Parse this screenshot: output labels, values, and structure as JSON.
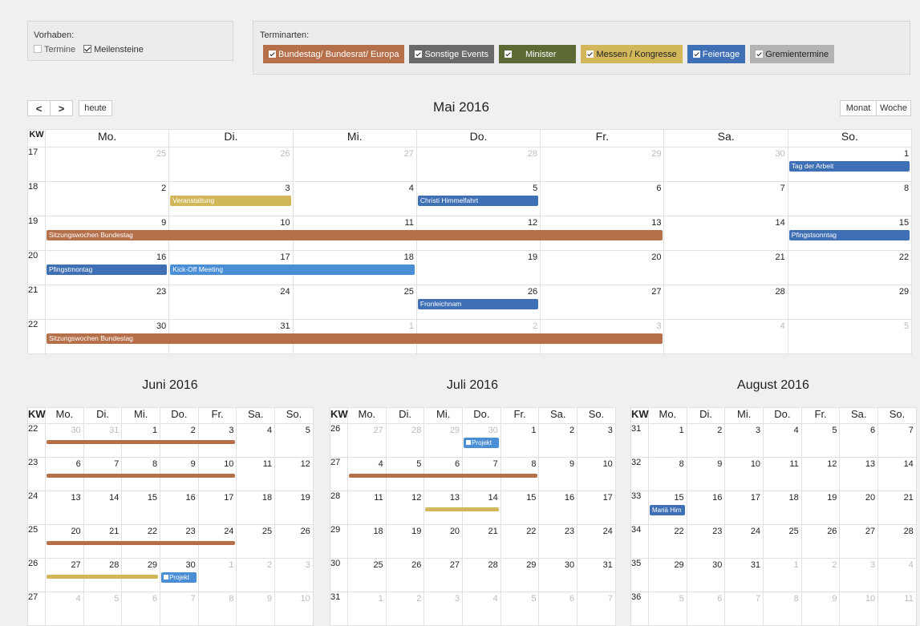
{
  "vorhaben": {
    "title": "Vorhaben:",
    "items": [
      {
        "label": "Termine",
        "checked": false
      },
      {
        "label": "Meilensteine",
        "checked": true
      }
    ]
  },
  "terminarten": {
    "title": "Terminarten:",
    "items": [
      {
        "label": "Bundestag/ Bundesrat/ Europa",
        "color": "#b5704a",
        "text_color": "#ffffff",
        "checked": true
      },
      {
        "label": "Sonstige Events",
        "color": "#6a6a6a",
        "text_color": "#ffffff",
        "checked": true
      },
      {
        "label": "Minister",
        "color": "#5c6a36",
        "text_color": "#ffffff",
        "checked": true
      },
      {
        "label": "Messen / Kongresse",
        "color": "#d1b75a",
        "text_color": "#222222",
        "checked": true
      },
      {
        "label": "Feiertage",
        "color": "#3f6fb5",
        "text_color": "#ffffff",
        "checked": true
      },
      {
        "label": "Gremientermine",
        "color": "#b3b3b3",
        "text_color": "#222222",
        "checked": true
      }
    ]
  },
  "toolbar": {
    "prev_label": "<",
    "next_label": ">",
    "today_label": "heute",
    "title": "Mai 2016",
    "month_label": "Monat",
    "week_label": "Woche"
  },
  "colors": {
    "bundestag": "#b5704a",
    "feiertag": "#3f6fb5",
    "messen": "#d1b75a",
    "event": "#4a8fd6"
  },
  "main_calendar": {
    "kw_header": "KW",
    "weekdays": [
      "Mo.",
      "Di.",
      "Mi.",
      "Do.",
      "Fr.",
      "Sa.",
      "So."
    ],
    "weeks": [
      {
        "kw": "17",
        "days": [
          {
            "n": "25",
            "o": true
          },
          {
            "n": "26",
            "o": true
          },
          {
            "n": "27",
            "o": true
          },
          {
            "n": "28",
            "o": true
          },
          {
            "n": "29",
            "o": true
          },
          {
            "n": "30",
            "o": true
          },
          {
            "n": "1",
            "o": false
          }
        ]
      },
      {
        "kw": "18",
        "days": [
          {
            "n": "2",
            "o": false
          },
          {
            "n": "3",
            "o": false
          },
          {
            "n": "4",
            "o": false
          },
          {
            "n": "5",
            "o": false
          },
          {
            "n": "6",
            "o": false
          },
          {
            "n": "7",
            "o": false
          },
          {
            "n": "8",
            "o": false
          }
        ]
      },
      {
        "kw": "19",
        "days": [
          {
            "n": "9",
            "o": false
          },
          {
            "n": "10",
            "o": false
          },
          {
            "n": "11",
            "o": false
          },
          {
            "n": "12",
            "o": false
          },
          {
            "n": "13",
            "o": false
          },
          {
            "n": "14",
            "o": false
          },
          {
            "n": "15",
            "o": false
          }
        ]
      },
      {
        "kw": "20",
        "days": [
          {
            "n": "16",
            "o": false
          },
          {
            "n": "17",
            "o": false
          },
          {
            "n": "18",
            "o": false
          },
          {
            "n": "19",
            "o": false
          },
          {
            "n": "20",
            "o": false
          },
          {
            "n": "21",
            "o": false
          },
          {
            "n": "22",
            "o": false
          }
        ]
      },
      {
        "kw": "21",
        "days": [
          {
            "n": "23",
            "o": false
          },
          {
            "n": "24",
            "o": false
          },
          {
            "n": "25",
            "o": false
          },
          {
            "n": "26",
            "o": false
          },
          {
            "n": "27",
            "o": false
          },
          {
            "n": "28",
            "o": false
          },
          {
            "n": "29",
            "o": false
          }
        ]
      },
      {
        "kw": "22",
        "days": [
          {
            "n": "30",
            "o": false
          },
          {
            "n": "31",
            "o": false
          },
          {
            "n": "1",
            "o": true
          },
          {
            "n": "2",
            "o": true
          },
          {
            "n": "3",
            "o": true
          },
          {
            "n": "4",
            "o": true
          },
          {
            "n": "5",
            "o": true
          }
        ]
      }
    ],
    "events": [
      {
        "week": 0,
        "start": 6,
        "span": 1,
        "label": "Tag der Arbeit",
        "color": "#3f6fb5"
      },
      {
        "week": 1,
        "start": 1,
        "span": 1,
        "label": "Veranstaltung",
        "color": "#d1b75a"
      },
      {
        "week": 1,
        "start": 3,
        "span": 1,
        "label": "Christi Himmelfahrt",
        "color": "#3f6fb5"
      },
      {
        "week": 2,
        "start": 0,
        "span": 5,
        "label": "Sitzungswochen Bundestag",
        "color": "#b5704a"
      },
      {
        "week": 2,
        "start": 6,
        "span": 1,
        "label": "Pfingstsonntag",
        "color": "#3f6fb5"
      },
      {
        "week": 3,
        "start": 0,
        "span": 1,
        "label": "Pfingstmontag",
        "color": "#3f6fb5"
      },
      {
        "week": 3,
        "start": 1,
        "span": 2,
        "label": "Kick-Off Meeting",
        "color": "#4a8fd6"
      },
      {
        "week": 4,
        "start": 3,
        "span": 1,
        "label": "Fronleichnam",
        "color": "#3f6fb5"
      },
      {
        "week": 5,
        "start": 0,
        "span": 5,
        "label": "Sitzungswochen Bundestag",
        "color": "#b5704a"
      }
    ]
  },
  "small_calendars": [
    {
      "title": "Juni 2016",
      "kw_header": "KW",
      "weekdays": [
        "Mo.",
        "Di.",
        "Mi.",
        "Do.",
        "Fr.",
        "Sa.",
        "So."
      ],
      "weeks": [
        {
          "kw": "22",
          "days": [
            {
              "n": "30",
              "o": true
            },
            {
              "n": "31",
              "o": true
            },
            {
              "n": "1",
              "o": false
            },
            {
              "n": "2",
              "o": false
            },
            {
              "n": "3",
              "o": false
            },
            {
              "n": "4",
              "o": false
            },
            {
              "n": "5",
              "o": false
            }
          ]
        },
        {
          "kw": "23",
          "days": [
            {
              "n": "6",
              "o": false
            },
            {
              "n": "7",
              "o": false
            },
            {
              "n": "8",
              "o": false
            },
            {
              "n": "9",
              "o": false
            },
            {
              "n": "10",
              "o": false
            },
            {
              "n": "11",
              "o": false
            },
            {
              "n": "12",
              "o": false
            }
          ]
        },
        {
          "kw": "24",
          "days": [
            {
              "n": "13",
              "o": false
            },
            {
              "n": "14",
              "o": false
            },
            {
              "n": "15",
              "o": false
            },
            {
              "n": "16",
              "o": false
            },
            {
              "n": "17",
              "o": false
            },
            {
              "n": "18",
              "o": false
            },
            {
              "n": "19",
              "o": false
            }
          ]
        },
        {
          "kw": "25",
          "days": [
            {
              "n": "20",
              "o": false
            },
            {
              "n": "21",
              "o": false
            },
            {
              "n": "22",
              "o": false
            },
            {
              "n": "23",
              "o": false
            },
            {
              "n": "24",
              "o": false
            },
            {
              "n": "25",
              "o": false
            },
            {
              "n": "26",
              "o": false
            }
          ]
        },
        {
          "kw": "26",
          "days": [
            {
              "n": "27",
              "o": false
            },
            {
              "n": "28",
              "o": false
            },
            {
              "n": "29",
              "o": false
            },
            {
              "n": "30",
              "o": false
            },
            {
              "n": "1",
              "o": true
            },
            {
              "n": "2",
              "o": true
            },
            {
              "n": "3",
              "o": true
            }
          ]
        },
        {
          "kw": "27",
          "days": [
            {
              "n": "4",
              "o": true
            },
            {
              "n": "5",
              "o": true
            },
            {
              "n": "6",
              "o": true
            },
            {
              "n": "7",
              "o": true
            },
            {
              "n": "8",
              "o": true
            },
            {
              "n": "9",
              "o": true
            },
            {
              "n": "10",
              "o": true
            }
          ]
        }
      ],
      "bars": [
        {
          "week": 0,
          "start": 0,
          "span": 5,
          "color": "#b5704a"
        },
        {
          "week": 1,
          "start": 0,
          "span": 5,
          "color": "#b5704a"
        },
        {
          "week": 3,
          "start": 0,
          "span": 5,
          "color": "#b5704a"
        },
        {
          "week": 4,
          "start": 0,
          "span": 3,
          "color": "#d1b75a"
        }
      ],
      "tags": [
        {
          "week": 4,
          "start": 3,
          "label": "Projekt",
          "color": "#4a8fd6",
          "flag": true
        }
      ]
    },
    {
      "title": "Juli 2016",
      "kw_header": "KW",
      "weekdays": [
        "Mo.",
        "Di.",
        "Mi.",
        "Do.",
        "Fr.",
        "Sa.",
        "So."
      ],
      "weeks": [
        {
          "kw": "26",
          "days": [
            {
              "n": "27",
              "o": true
            },
            {
              "n": "28",
              "o": true
            },
            {
              "n": "29",
              "o": true
            },
            {
              "n": "30",
              "o": true
            },
            {
              "n": "1",
              "o": false
            },
            {
              "n": "2",
              "o": false
            },
            {
              "n": "3",
              "o": false
            }
          ]
        },
        {
          "kw": "27",
          "days": [
            {
              "n": "4",
              "o": false
            },
            {
              "n": "5",
              "o": false
            },
            {
              "n": "6",
              "o": false
            },
            {
              "n": "7",
              "o": false
            },
            {
              "n": "8",
              "o": false
            },
            {
              "n": "9",
              "o": false
            },
            {
              "n": "10",
              "o": false
            }
          ]
        },
        {
          "kw": "28",
          "days": [
            {
              "n": "11",
              "o": false
            },
            {
              "n": "12",
              "o": false
            },
            {
              "n": "13",
              "o": false
            },
            {
              "n": "14",
              "o": false
            },
            {
              "n": "15",
              "o": false
            },
            {
              "n": "16",
              "o": false
            },
            {
              "n": "17",
              "o": false
            }
          ]
        },
        {
          "kw": "29",
          "days": [
            {
              "n": "18",
              "o": false
            },
            {
              "n": "19",
              "o": false
            },
            {
              "n": "20",
              "o": false
            },
            {
              "n": "21",
              "o": false
            },
            {
              "n": "22",
              "o": false
            },
            {
              "n": "23",
              "o": false
            },
            {
              "n": "24",
              "o": false
            }
          ]
        },
        {
          "kw": "30",
          "days": [
            {
              "n": "25",
              "o": false
            },
            {
              "n": "26",
              "o": false
            },
            {
              "n": "27",
              "o": false
            },
            {
              "n": "28",
              "o": false
            },
            {
              "n": "29",
              "o": false
            },
            {
              "n": "30",
              "o": false
            },
            {
              "n": "31",
              "o": false
            }
          ]
        },
        {
          "kw": "31",
          "days": [
            {
              "n": "1",
              "o": true
            },
            {
              "n": "2",
              "o": true
            },
            {
              "n": "3",
              "o": true
            },
            {
              "n": "4",
              "o": true
            },
            {
              "n": "5",
              "o": true
            },
            {
              "n": "6",
              "o": true
            },
            {
              "n": "7",
              "o": true
            }
          ]
        }
      ],
      "bars": [
        {
          "week": 1,
          "start": 0,
          "span": 5,
          "color": "#b5704a"
        },
        {
          "week": 2,
          "start": 2,
          "span": 2,
          "color": "#d1b75a"
        }
      ],
      "tags": [
        {
          "week": 0,
          "start": 3,
          "label": "Projekt",
          "color": "#4a8fd6",
          "flag": true
        }
      ]
    },
    {
      "title": "August 2016",
      "kw_header": "KW",
      "weekdays": [
        "Mo.",
        "Di.",
        "Mi.",
        "Do.",
        "Fr.",
        "Sa.",
        "So."
      ],
      "weeks": [
        {
          "kw": "31",
          "days": [
            {
              "n": "1",
              "o": false
            },
            {
              "n": "2",
              "o": false
            },
            {
              "n": "3",
              "o": false
            },
            {
              "n": "4",
              "o": false
            },
            {
              "n": "5",
              "o": false
            },
            {
              "n": "6",
              "o": false
            },
            {
              "n": "7",
              "o": false
            }
          ]
        },
        {
          "kw": "32",
          "days": [
            {
              "n": "8",
              "o": false
            },
            {
              "n": "9",
              "o": false
            },
            {
              "n": "10",
              "o": false
            },
            {
              "n": "11",
              "o": false
            },
            {
              "n": "12",
              "o": false
            },
            {
              "n": "13",
              "o": false
            },
            {
              "n": "14",
              "o": false
            }
          ]
        },
        {
          "kw": "33",
          "days": [
            {
              "n": "15",
              "o": false
            },
            {
              "n": "16",
              "o": false
            },
            {
              "n": "17",
              "o": false
            },
            {
              "n": "18",
              "o": false
            },
            {
              "n": "19",
              "o": false
            },
            {
              "n": "20",
              "o": false
            },
            {
              "n": "21",
              "o": false
            }
          ]
        },
        {
          "kw": "34",
          "days": [
            {
              "n": "22",
              "o": false
            },
            {
              "n": "23",
              "o": false
            },
            {
              "n": "24",
              "o": false
            },
            {
              "n": "25",
              "o": false
            },
            {
              "n": "26",
              "o": false
            },
            {
              "n": "27",
              "o": false
            },
            {
              "n": "28",
              "o": false
            }
          ]
        },
        {
          "kw": "35",
          "days": [
            {
              "n": "29",
              "o": false
            },
            {
              "n": "30",
              "o": false
            },
            {
              "n": "31",
              "o": false
            },
            {
              "n": "1",
              "o": true
            },
            {
              "n": "2",
              "o": true
            },
            {
              "n": "3",
              "o": true
            },
            {
              "n": "4",
              "o": true
            }
          ]
        },
        {
          "kw": "36",
          "days": [
            {
              "n": "5",
              "o": true
            },
            {
              "n": "6",
              "o": true
            },
            {
              "n": "7",
              "o": true
            },
            {
              "n": "8",
              "o": true
            },
            {
              "n": "9",
              "o": true
            },
            {
              "n": "10",
              "o": true
            },
            {
              "n": "11",
              "o": true
            }
          ]
        }
      ],
      "bars": [],
      "tags": [
        {
          "week": 2,
          "start": 0,
          "label": "Mariä Him",
          "color": "#3f6fb5",
          "flag": false
        }
      ]
    }
  ]
}
